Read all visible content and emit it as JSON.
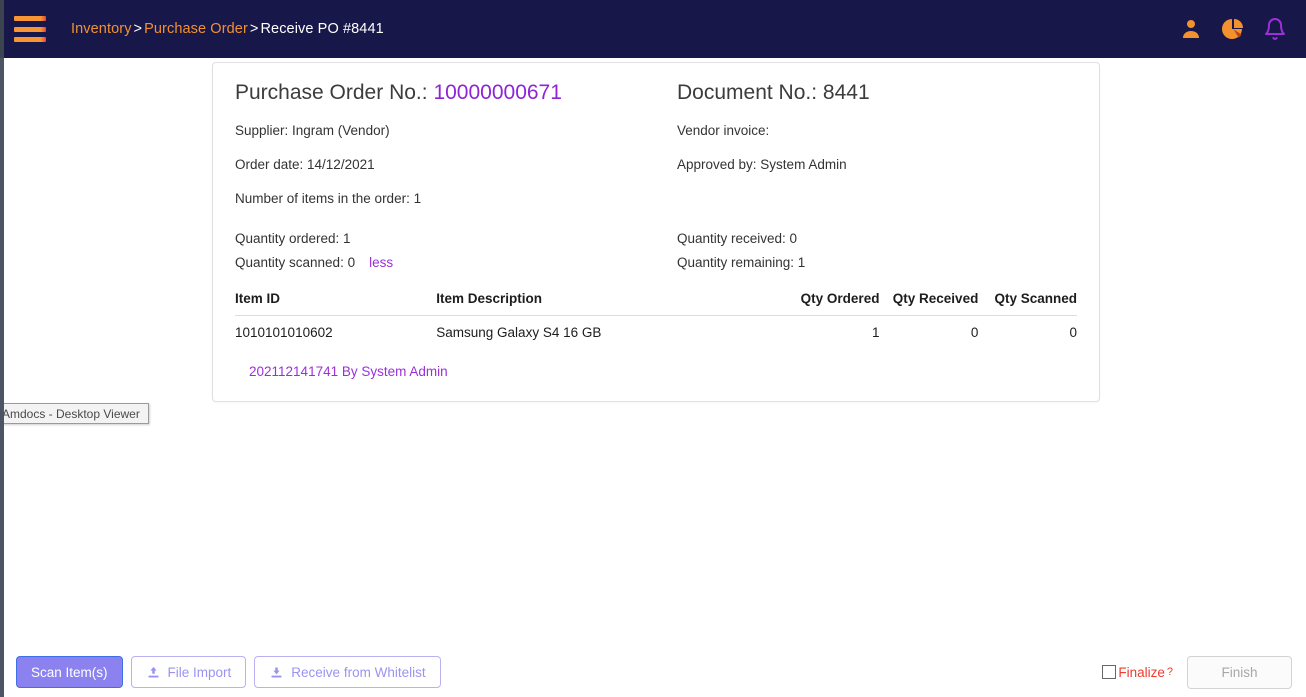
{
  "topbar": {
    "menu_icon": "hamburger-menu-icon",
    "breadcrumb": {
      "item1": "Inventory",
      "sep1": ">",
      "item2": "Purchase Order",
      "sep2": ">",
      "current": "Receive PO #8441"
    },
    "icons": [
      {
        "name": "user-icon",
        "color": "#f3912e"
      },
      {
        "name": "pie-chart-icon",
        "color": "#f3912e"
      },
      {
        "name": "notification-bell-icon",
        "color": "#9b30d9"
      }
    ],
    "bg_color": "#17174a"
  },
  "order": {
    "po_label": "Purchase Order No.:",
    "po_number": "10000000671",
    "doc_label": "Document No.:",
    "doc_number": "8441",
    "supplier": "Supplier: Ingram (Vendor)",
    "vendor_invoice": "Vendor invoice:",
    "order_date": "Order date: 14/12/2021",
    "approved_by": "Approved by: System Admin",
    "number_of_items": "Number of items in the order: 1",
    "qty_ordered": "Quantity ordered: 1",
    "qty_received": "Quantity received: 0",
    "qty_scanned": "Quantity scanned: 0",
    "less_link": "less",
    "qty_remaining": "Quantity remaining: 1",
    "link_color": "#8e24d6"
  },
  "items_table": {
    "headers": [
      "Item ID",
      "Item Description",
      "Qty Ordered",
      "Qty Received",
      "Qty Scanned"
    ],
    "rows": [
      {
        "item_id": "1010101010602",
        "description": "Samsung Galaxy S4 16 GB",
        "qty_ordered": "1",
        "qty_received": "0",
        "qty_scanned": "0"
      }
    ],
    "scan_note": "202112141741 By System Admin"
  },
  "viewer_tooltip": {
    "text": "Amdocs - Desktop Viewer"
  },
  "actions": {
    "scan_items": "Scan Item(s)",
    "file_import": "File Import",
    "file_import_icon": "upload-icon",
    "receive_whitelist": "Receive from Whitelist",
    "receive_whitelist_icon": "download-icon",
    "finalize": "Finalize",
    "finalize_help": "?",
    "finish": "Finish",
    "primary_color": "#8b82ef",
    "finalize_color": "#ed3b2f"
  }
}
